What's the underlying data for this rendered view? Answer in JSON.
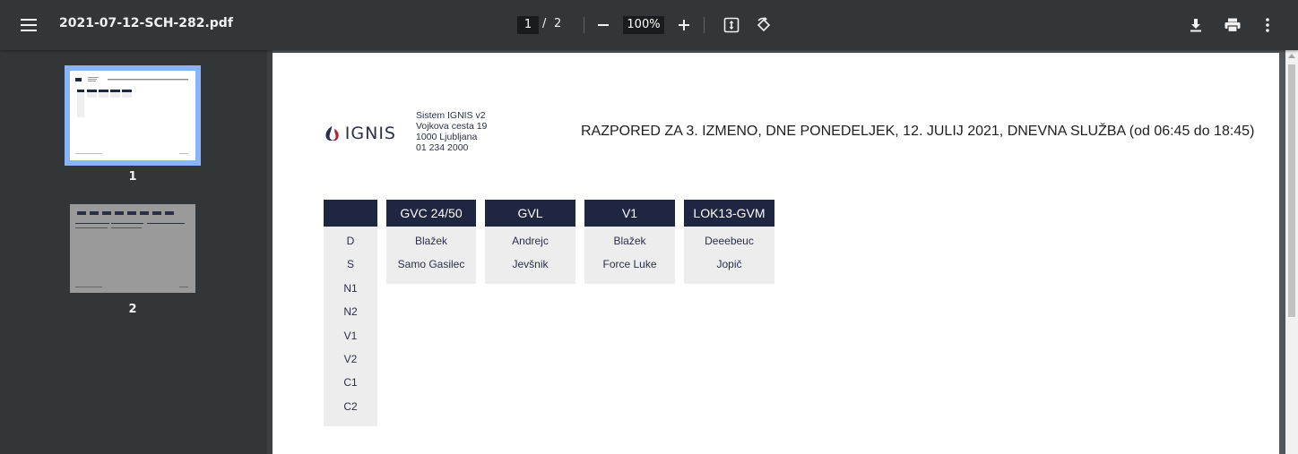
{
  "toolbar": {
    "file_name": "2021-07-12-SCH-282.pdf",
    "current_page": "1",
    "page_separator": "/",
    "total_pages": "2",
    "zoom": "100%",
    "icons": [
      "menu-icon",
      "zoom-out-icon",
      "zoom-in-icon",
      "fit-page-icon",
      "rotate-icon",
      "download-icon",
      "print-icon",
      "more-vert-icon"
    ]
  },
  "thumbnails": [
    {
      "label": "1",
      "selected": true
    },
    {
      "label": "2",
      "selected": false
    }
  ],
  "document": {
    "logo_text": "IGNIS",
    "address_lines": [
      "Sistem IGNIS v2",
      "Vojkova cesta 19",
      "1000 Ljubljana",
      "01 234 2000"
    ],
    "title": "RAZPORED ZA 3. IZMENO, DNE PONEDELJEK, 12. JULIJ 2021, DNEVNA SLUŽBA (od 06:45 do 18:45)",
    "row_labels": [
      "D",
      "S",
      "N1",
      "N2",
      "V1",
      "V2",
      "C1",
      "C2"
    ],
    "columns": [
      {
        "header": "GVC 24/50",
        "cells": [
          "Blažek",
          "Samo Gasilec"
        ]
      },
      {
        "header": "GVL",
        "cells": [
          "Andrejc",
          "Jevšnik"
        ]
      },
      {
        "header": "V1",
        "cells": [
          "Blažek",
          "Force Luke"
        ]
      },
      {
        "header": "LOK13-GVM",
        "cells": [
          "Deeebeuc",
          "Jopič"
        ]
      }
    ]
  },
  "colors": {
    "toolbar_bg": "#323639",
    "header_bg": "#1f2642",
    "cell_bg": "#ededed",
    "thumb_selected": "#8ab4f8",
    "logo_red": "#a8283a"
  }
}
